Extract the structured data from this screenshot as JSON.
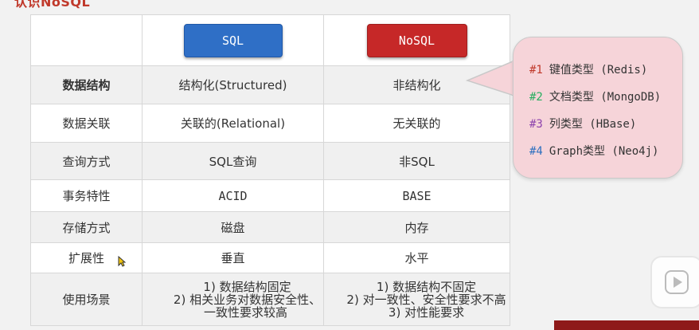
{
  "slide": {
    "title": "认识NoSQL"
  },
  "headers": {
    "sql": "SQL",
    "nosql": "NoSQL"
  },
  "rows": [
    {
      "label": "数据结构",
      "sql": "结构化(Structured)",
      "nosql": "非结构化"
    },
    {
      "label": "数据关联",
      "sql": "关联的(Relational)",
      "nosql": "无关联的"
    },
    {
      "label": "查询方式",
      "sql": "SQL查询",
      "nosql": "非SQL"
    },
    {
      "label": "事务特性",
      "sql": "ACID",
      "nosql": "BASE"
    },
    {
      "label": "存储方式",
      "sql": "磁盘",
      "nosql": "内存"
    },
    {
      "label": "扩展性",
      "sql": "垂直",
      "nosql": "水平"
    },
    {
      "label": "使用场景",
      "sql_lines": [
        "1) 数据结构固定",
        "2) 相关业务对数据安全性、",
        "一致性要求较高"
      ],
      "nosql_lines": [
        "1) 数据结构不固定",
        "2) 对一致性、安全性要求不高",
        "3) 对性能要求"
      ]
    }
  ],
  "callout": {
    "items": [
      {
        "num": "#1",
        "text": "键值类型 (Redis)",
        "color": "#c0392b"
      },
      {
        "num": "#2",
        "text": "文档类型 (MongoDB)",
        "color": "#27ae60"
      },
      {
        "num": "#3",
        "text": "列类型 (HBase)",
        "color": "#8e44ad"
      },
      {
        "num": "#4",
        "text": "Graph类型 (Neo4j)",
        "color": "#2c6fbf"
      }
    ]
  },
  "colors": {
    "sql_button": "#2f6fc6",
    "nosql_button": "#c62828",
    "callout_bg": "#f6d4d9"
  },
  "overlay": {
    "play_icon": "play-icon",
    "cursor_icon": "mouse-cursor-icon"
  }
}
